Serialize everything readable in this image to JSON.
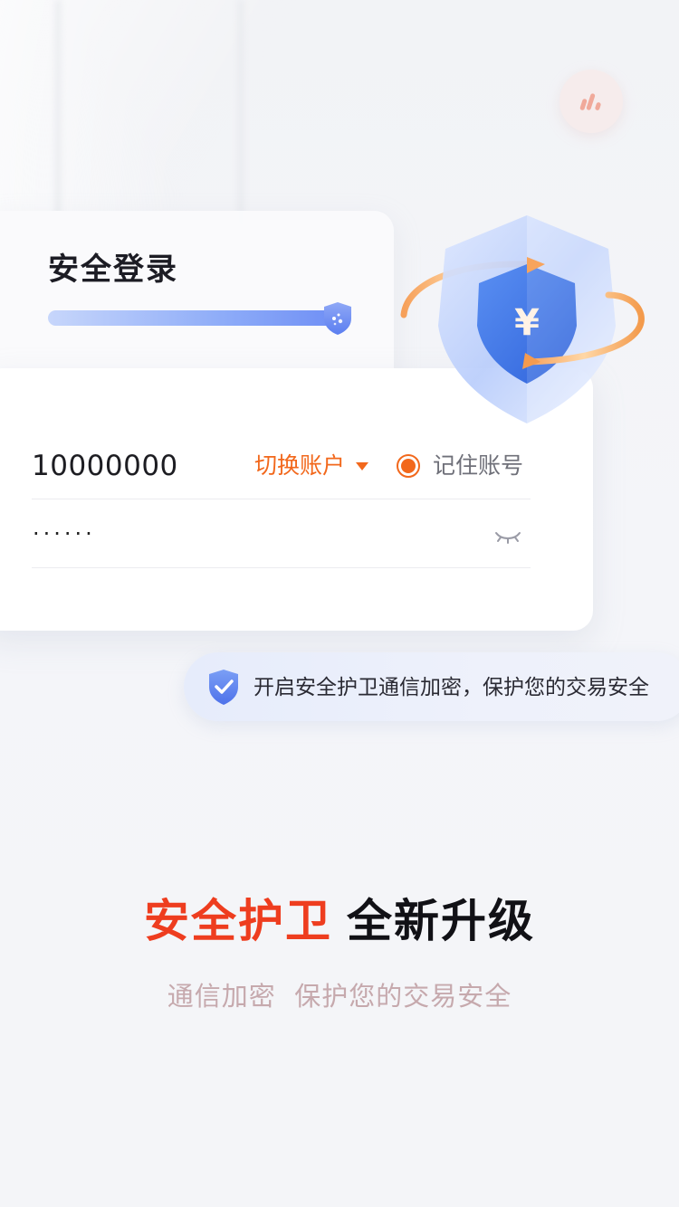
{
  "login": {
    "title": "安全登录",
    "account": "10000000",
    "switch_account": "切换账户",
    "remember_account": "记住账号",
    "remember_checked": true,
    "password_masked": "······"
  },
  "tip": {
    "text": "开启安全护卫通信加密，保护您的交易安全"
  },
  "promo": {
    "headline_highlight": "安全护卫",
    "headline_rest": "全新升级",
    "subline": "通信加密  保护您的交易安全"
  },
  "illustration": {
    "currency_symbol": "¥"
  },
  "colors": {
    "accent_orange": "#f2681c",
    "headline_red": "#ee3d1f",
    "progress_blue": "#6f8ff5",
    "subline_pink": "#c6a9ad"
  }
}
